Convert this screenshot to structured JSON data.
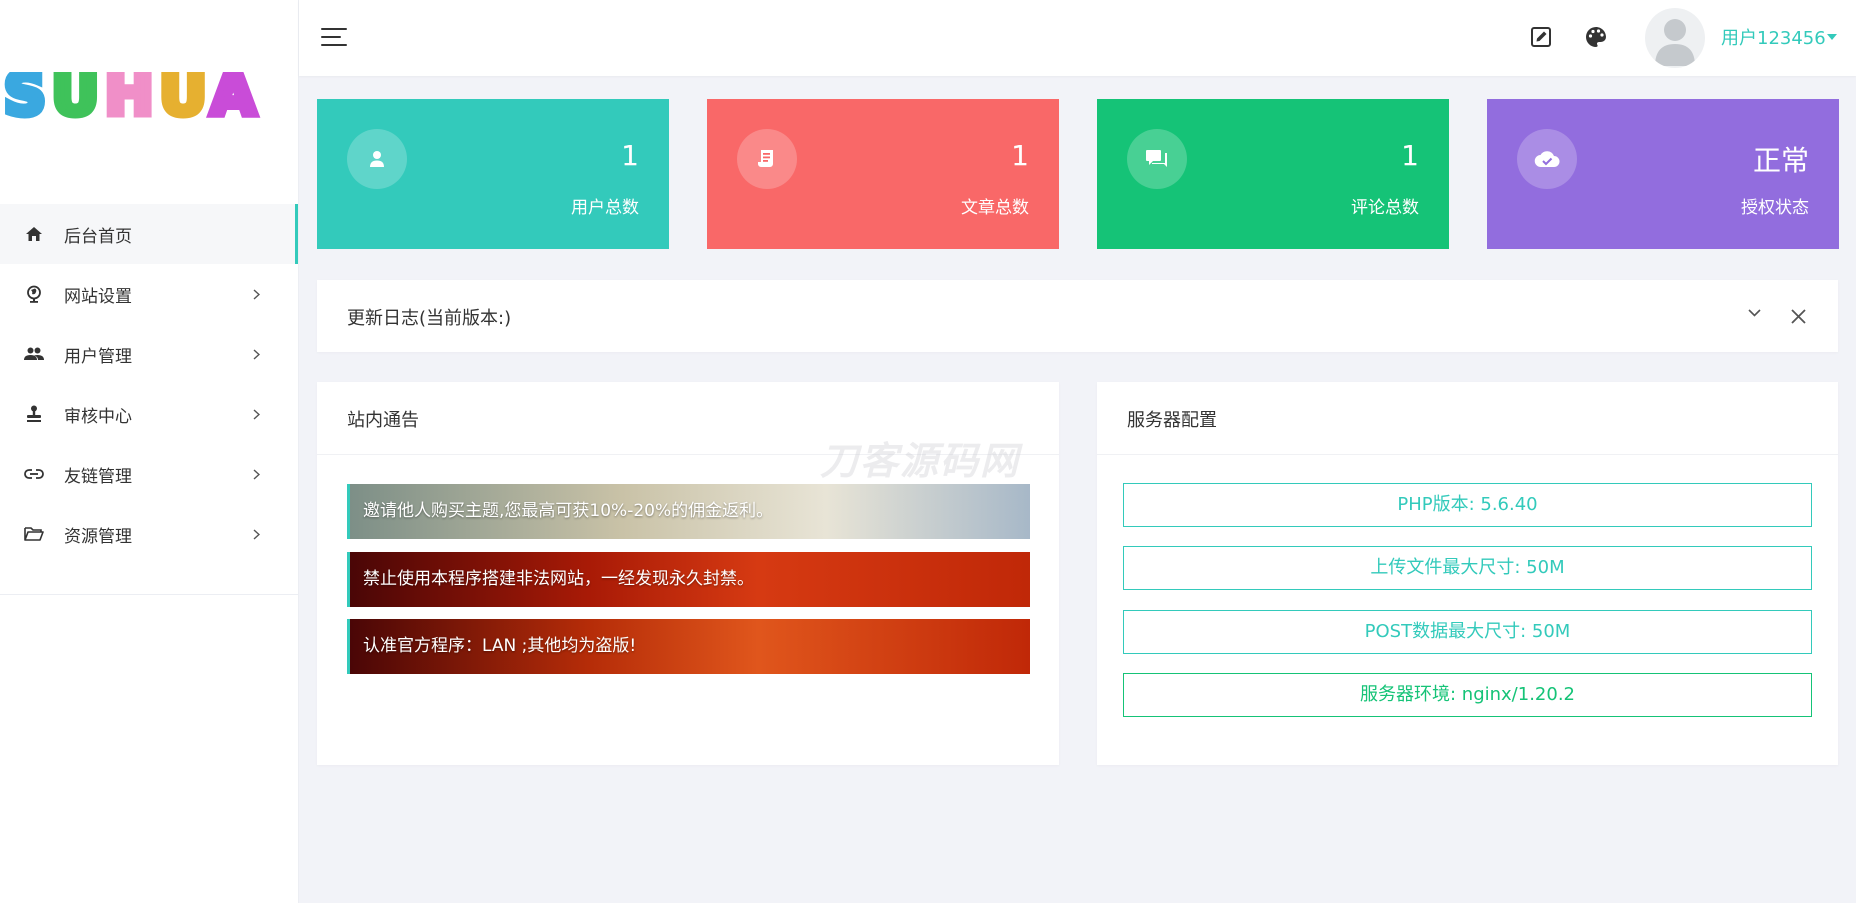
{
  "sidebar": {
    "logo_text": "SUHUA",
    "items": [
      {
        "label": "后台首页",
        "icon": "home-icon",
        "active": true
      },
      {
        "label": "网站设置",
        "icon": "globe-icon",
        "active": false
      },
      {
        "label": "用户管理",
        "icon": "users-icon",
        "active": false
      },
      {
        "label": "审核中心",
        "icon": "stamp-icon",
        "active": false
      },
      {
        "label": "友链管理",
        "icon": "link-icon",
        "active": false
      },
      {
        "label": "资源管理",
        "icon": "folder-icon",
        "active": false
      }
    ]
  },
  "header": {
    "username": "用户123456"
  },
  "stats": [
    {
      "value": "1",
      "label": "用户总数",
      "color": "#33cabb",
      "icon": "user-icon"
    },
    {
      "value": "1",
      "label": "文章总数",
      "color": "#f96868",
      "icon": "article-icon"
    },
    {
      "value": "1",
      "label": "评论总数",
      "color": "#15c377",
      "icon": "comments-icon"
    },
    {
      "value": "正常",
      "label": "授权状态",
      "color": "#926dde",
      "icon": "cloud-check-icon"
    }
  ],
  "changelog": {
    "title": "更新日志(当前版本:)"
  },
  "notices": {
    "title": "站内通告",
    "items": [
      "邀请他人购买主题,您最高可获10%-20%的佣金返利。",
      "禁止使用本程序搭建非法网站，一经发现永久封禁。",
      "认准官方程序：LAN ;其他均为盗版!"
    ]
  },
  "server": {
    "title": "服务器配置",
    "items": [
      "PHP版本: 5.6.40",
      "上传文件最大尺寸: 50M",
      "POST数据最大尺寸: 50M",
      "服务器环境: nginx/1.20.2"
    ]
  },
  "watermark": "刀客源码网",
  "colors": {
    "accent": "#33cabb",
    "danger": "#f96868",
    "success": "#15c377",
    "purple": "#926dde"
  }
}
